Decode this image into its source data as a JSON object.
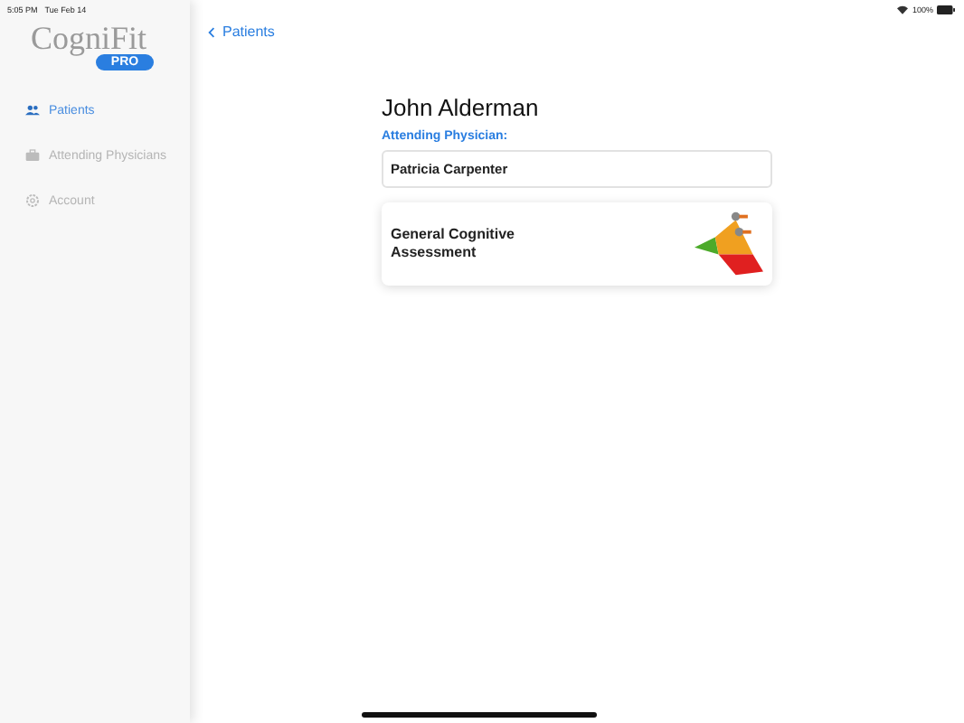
{
  "status_bar": {
    "time": "5:05 PM",
    "date": "Tue Feb 14",
    "battery": "100%"
  },
  "logo": {
    "name": "CogniFit",
    "badge": "PRO"
  },
  "sidebar": {
    "items": [
      {
        "label": "Patients",
        "kind": "people",
        "selected": true
      },
      {
        "label": "Attending Physicians",
        "kind": "briefcase",
        "selected": false
      },
      {
        "label": "Account",
        "kind": "gear",
        "selected": false
      }
    ]
  },
  "nav": {
    "back": "Patients"
  },
  "patient": {
    "name": "John Alderman",
    "physician_label": "Attending Physician:",
    "physician": "Patricia Carpenter"
  },
  "assessments": [
    {
      "title": "General Cognitive Assessment"
    }
  ]
}
